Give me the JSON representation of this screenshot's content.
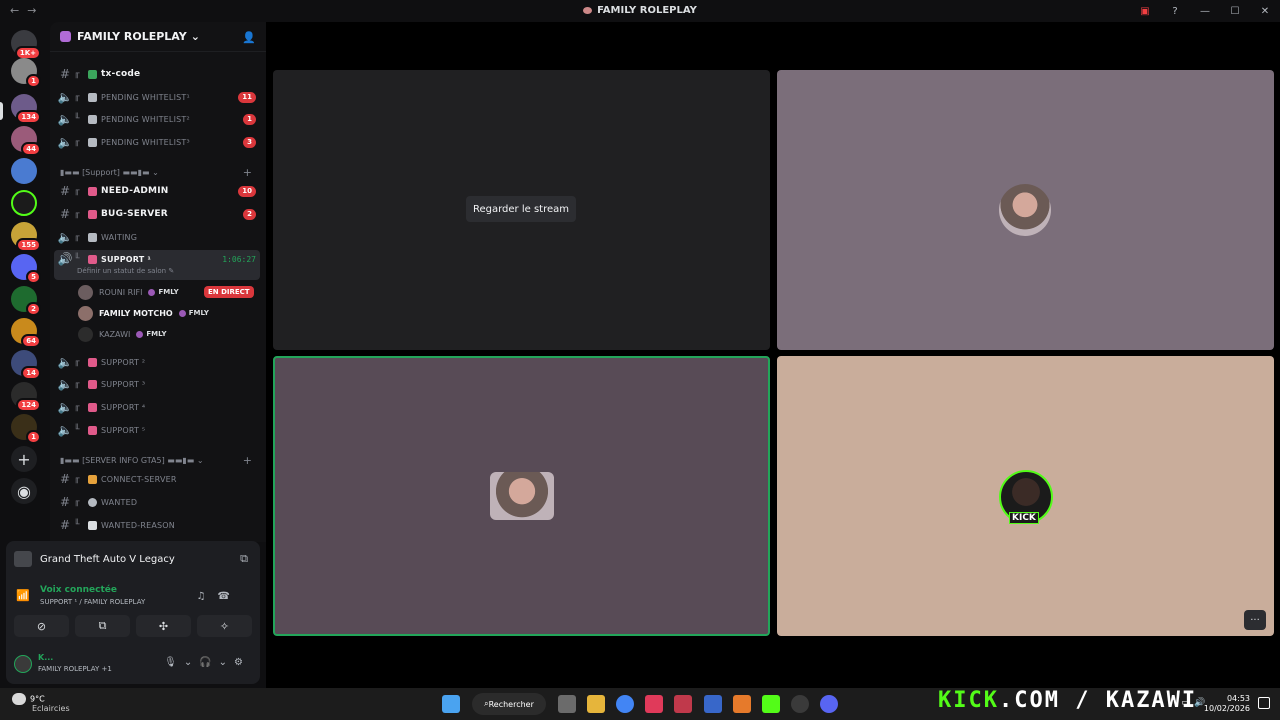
{
  "window": {
    "title": "FAMILY ROLEPLAY"
  },
  "rail": {
    "badges": [
      "1K+",
      "1",
      "134",
      "44",
      "155",
      "5",
      "2",
      "64",
      "14",
      "124",
      "1"
    ]
  },
  "guild": {
    "name": "FAMILY ROLEPLAY"
  },
  "channels": {
    "tx_code": "tx-code",
    "pending1": "PENDING WHITELIST¹",
    "pending1_count": "11",
    "pending2": "PENDING WHITELIST²",
    "pending2_count": "1",
    "pending3": "PENDING WHITELIST³",
    "pending3_count": "3",
    "cat_support": "▮▬▬ [Support] ▬▬▮▬ ⌄",
    "need_admin": "NEED-ADMIN",
    "need_admin_count": "10",
    "bug_server": "BUG-SERVER",
    "bug_server_count": "2",
    "waiting": "WAITING",
    "support1": "SUPPORT ¹",
    "support1_time": "1:06:27",
    "support1_status": "Définir un statut de salon ✎",
    "support2": "SUPPORT ²",
    "support3": "SUPPORT ³",
    "support4": "SUPPORT ⁴",
    "support5": "SUPPORT ⁵",
    "cat_server_info": "▮▬▬ [SERVER INFO GTA5] ▬▬▮▬ ⌄",
    "connect_server": "CONNECT-SERVER",
    "wanted": "WANTED",
    "wanted_reason": "WANTED-REASON"
  },
  "voice_users": [
    {
      "name": "ROUNI RIFI",
      "tag": "FMLY",
      "live": "EN DIRECT"
    },
    {
      "name": "FAMILY MOTCHO",
      "tag": "FMLY"
    },
    {
      "name": "KAZAWI",
      "tag": "FMLY"
    }
  ],
  "activity": {
    "game": "Grand Theft Auto V Legacy"
  },
  "voice_status": {
    "title": "Voix connectée",
    "channel": "SUPPORT ¹ / FAMILY ROLEPLAY"
  },
  "user": {
    "name": "K...",
    "status": "FAMILY ROLEPLAY +1"
  },
  "stage": {
    "watch_label": "Regarder le stream",
    "kick_badge": "KICK"
  },
  "taskbar": {
    "temp": "9°C",
    "weather": "Eclaircies",
    "search": "Rechercher",
    "watermark_kick": "KICK",
    "watermark_rest": ".COM / KAZAWI",
    "time": "04:53",
    "date": "10/02/2026"
  },
  "colors": {
    "online": "#23a55a",
    "alert": "#da373c",
    "kick": "#53fc18"
  }
}
